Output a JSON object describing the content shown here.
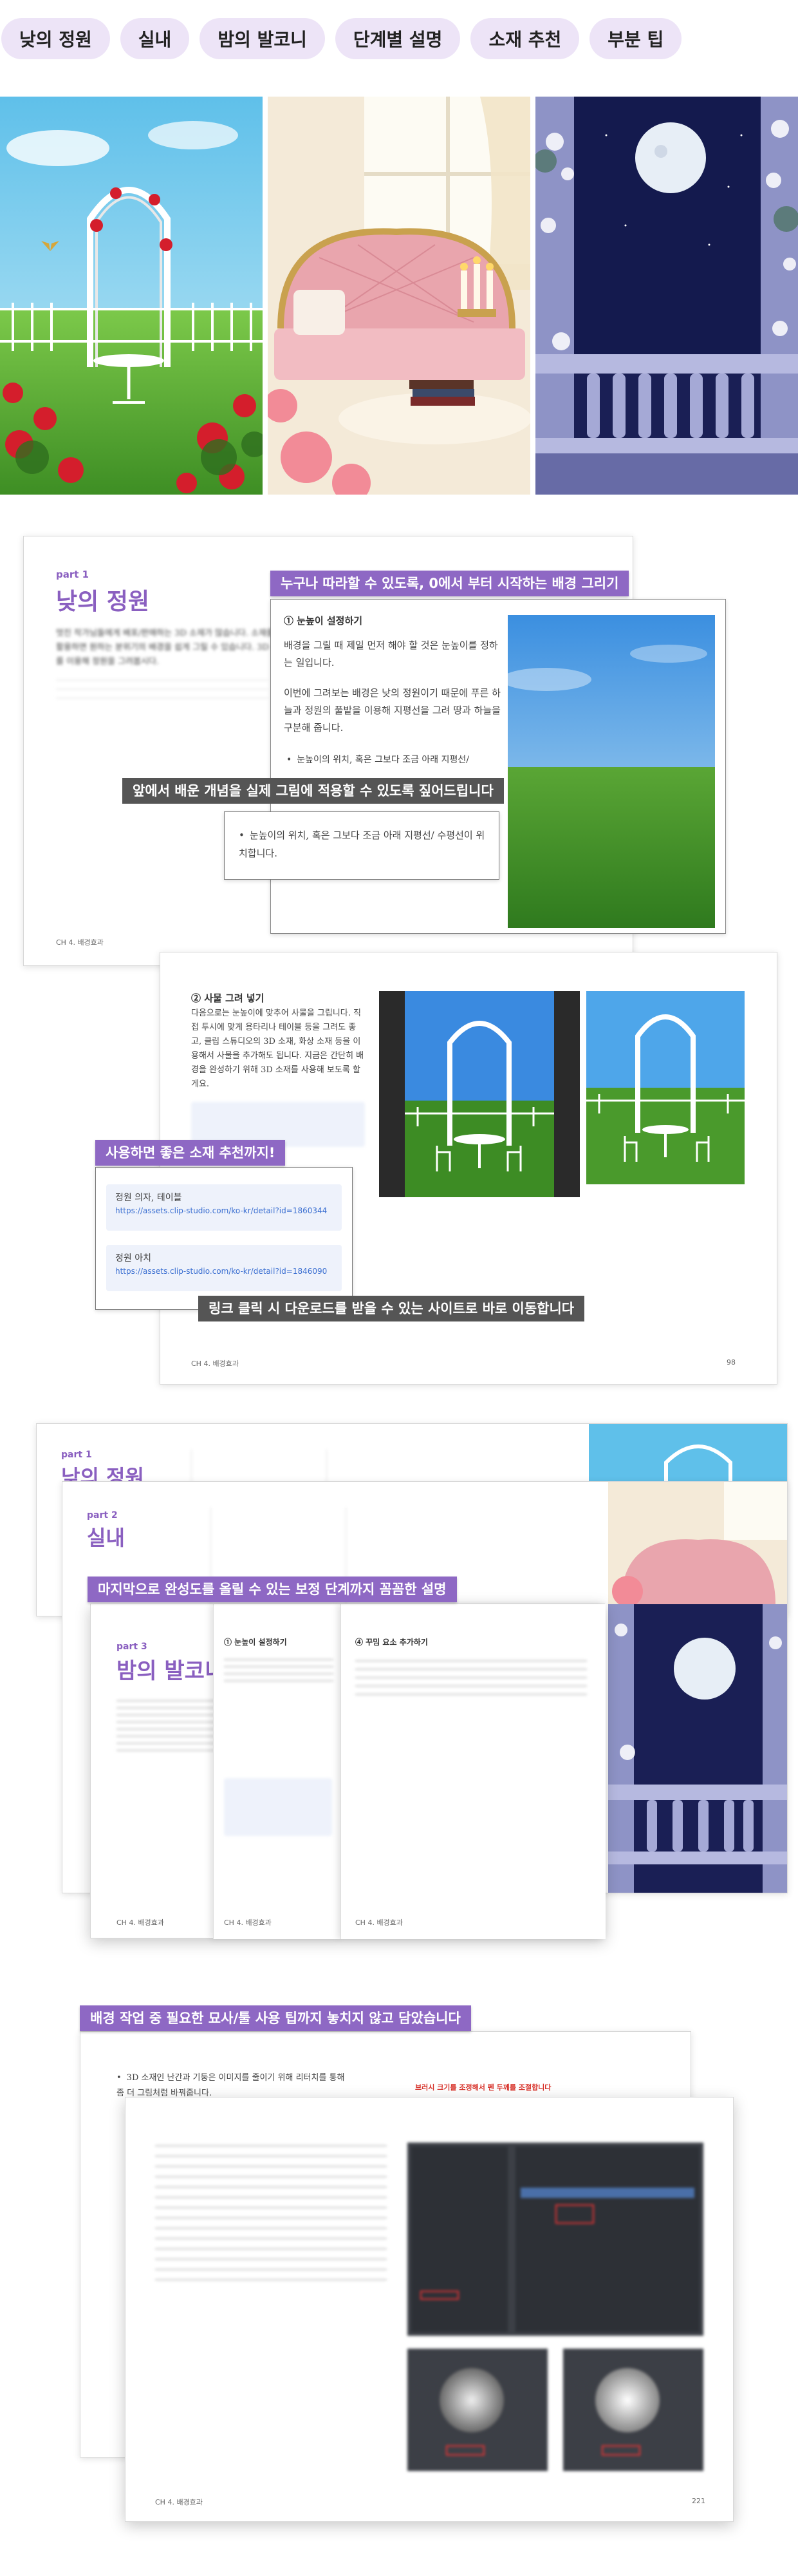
{
  "tabs": [
    "낮의 정원",
    "실내",
    "밤의 발코니",
    "단계별 설명",
    "소재 추천",
    "부분 팁"
  ],
  "section1": {
    "page_label": "part 1",
    "page_title": "낮의 정원",
    "page_intro": "멋진 작가님들에게 배포/판매하는 3D 소재가 많습니다. 소재를 잘 활용하면 원하는 분위기의 배경을 쉽게 그릴 수 있습니다. 3D 소재를 이용해 정원을 그려봅시다.",
    "footer": "CH 4. 배경효과",
    "banner_top": "누구나 따라할 수 있도록, 0에서 부터 시작하는 배경 그리기",
    "step_heading": "① 눈높이 설정하기",
    "step_body_1": "배경을 그릴 때 제일 먼저 해야 할 것은 눈높이를 정하는 일입니다.",
    "step_body_2": "이번에 그려보는 배경은 낮의 정원이기 때문에 푸른 하늘과 정원의 풀밭을 이용해 지평선을 그려 땅과 하늘을 구분해 줍니다.",
    "step_bullet": "눈높이의 위치, 혹은 그보다 조금 아래 지평선/",
    "banner_gray": "앞에서 배운 개념을 실제 그림에 적용할 수 있도록 짚어드립니다",
    "callout_text": "눈높이의 위치, 혹은 그보다 조금 아래 지평선/ 수평선이 위치합니다."
  },
  "section2": {
    "step_heading": "② 사물 그려 넣기",
    "step_body": "다음으로는 눈높이에 맞추어 사물을 그립니다. 직접 투시에 맞게 용타리나 테이블 등을 그려도 좋고, 클립 스튜디오의 3D 소재, 화상 소재 등을 이용해서 사물을 추가해도 됩니다. 지금은 간단히 배경을 완성하기 위해 3D 소재를 사용해 보도록 할게요.",
    "banner_purple": "사용하면 좋은 소재 추천까지!",
    "links": [
      {
        "name": "정원 의자, 테이블",
        "url": "https://assets.clip-studio.com/ko-kr/detail?id=1860344"
      },
      {
        "name": "정원 아치",
        "url": "https://assets.clip-studio.com/ko-kr/detail?id=1846090"
      }
    ],
    "banner_gray": "링크 클릭 시 다운로드를 받을 수 있는 사이트로 바로 이동합니다",
    "footer": "CH 4. 배경효과",
    "page_number": "98"
  },
  "section3": {
    "pages": [
      {
        "label": "part 1",
        "title": "낮의 정원"
      },
      {
        "label": "part 2",
        "title": "실내"
      },
      {
        "label": "part 3",
        "title": "밤의 발코니"
      }
    ],
    "banner_purple": "마지막으로 완성도를 올릴 수 있는 보정 단계까지 꼼꼼한 설명",
    "step1": "① 눈높이 설정하기",
    "step4": "④ 꾸밈 요소 추가하기",
    "footer": "CH 4. 배경효과"
  },
  "section4": {
    "banner_purple": "배경 작업 중 필요한 묘사/툴 사용 팁까지 놓치지 않고 담았습니다",
    "bullet": "3D 소재인 난간과 기둥은 이미지를 줄이기 위해 리터치를 통해 좀 더 그림처럼 바꿔줍니다.",
    "red_note": "브러시 크기를 조정해서 펜 두께를 조절합니다",
    "footer": "CH 4. 배경효과",
    "page_number": "221"
  },
  "colors": {
    "accent_purple": "#8e68c4",
    "tab_bg": "#ede4f7",
    "banner_gray": "#555555",
    "link_blue": "#3b6fd1"
  }
}
